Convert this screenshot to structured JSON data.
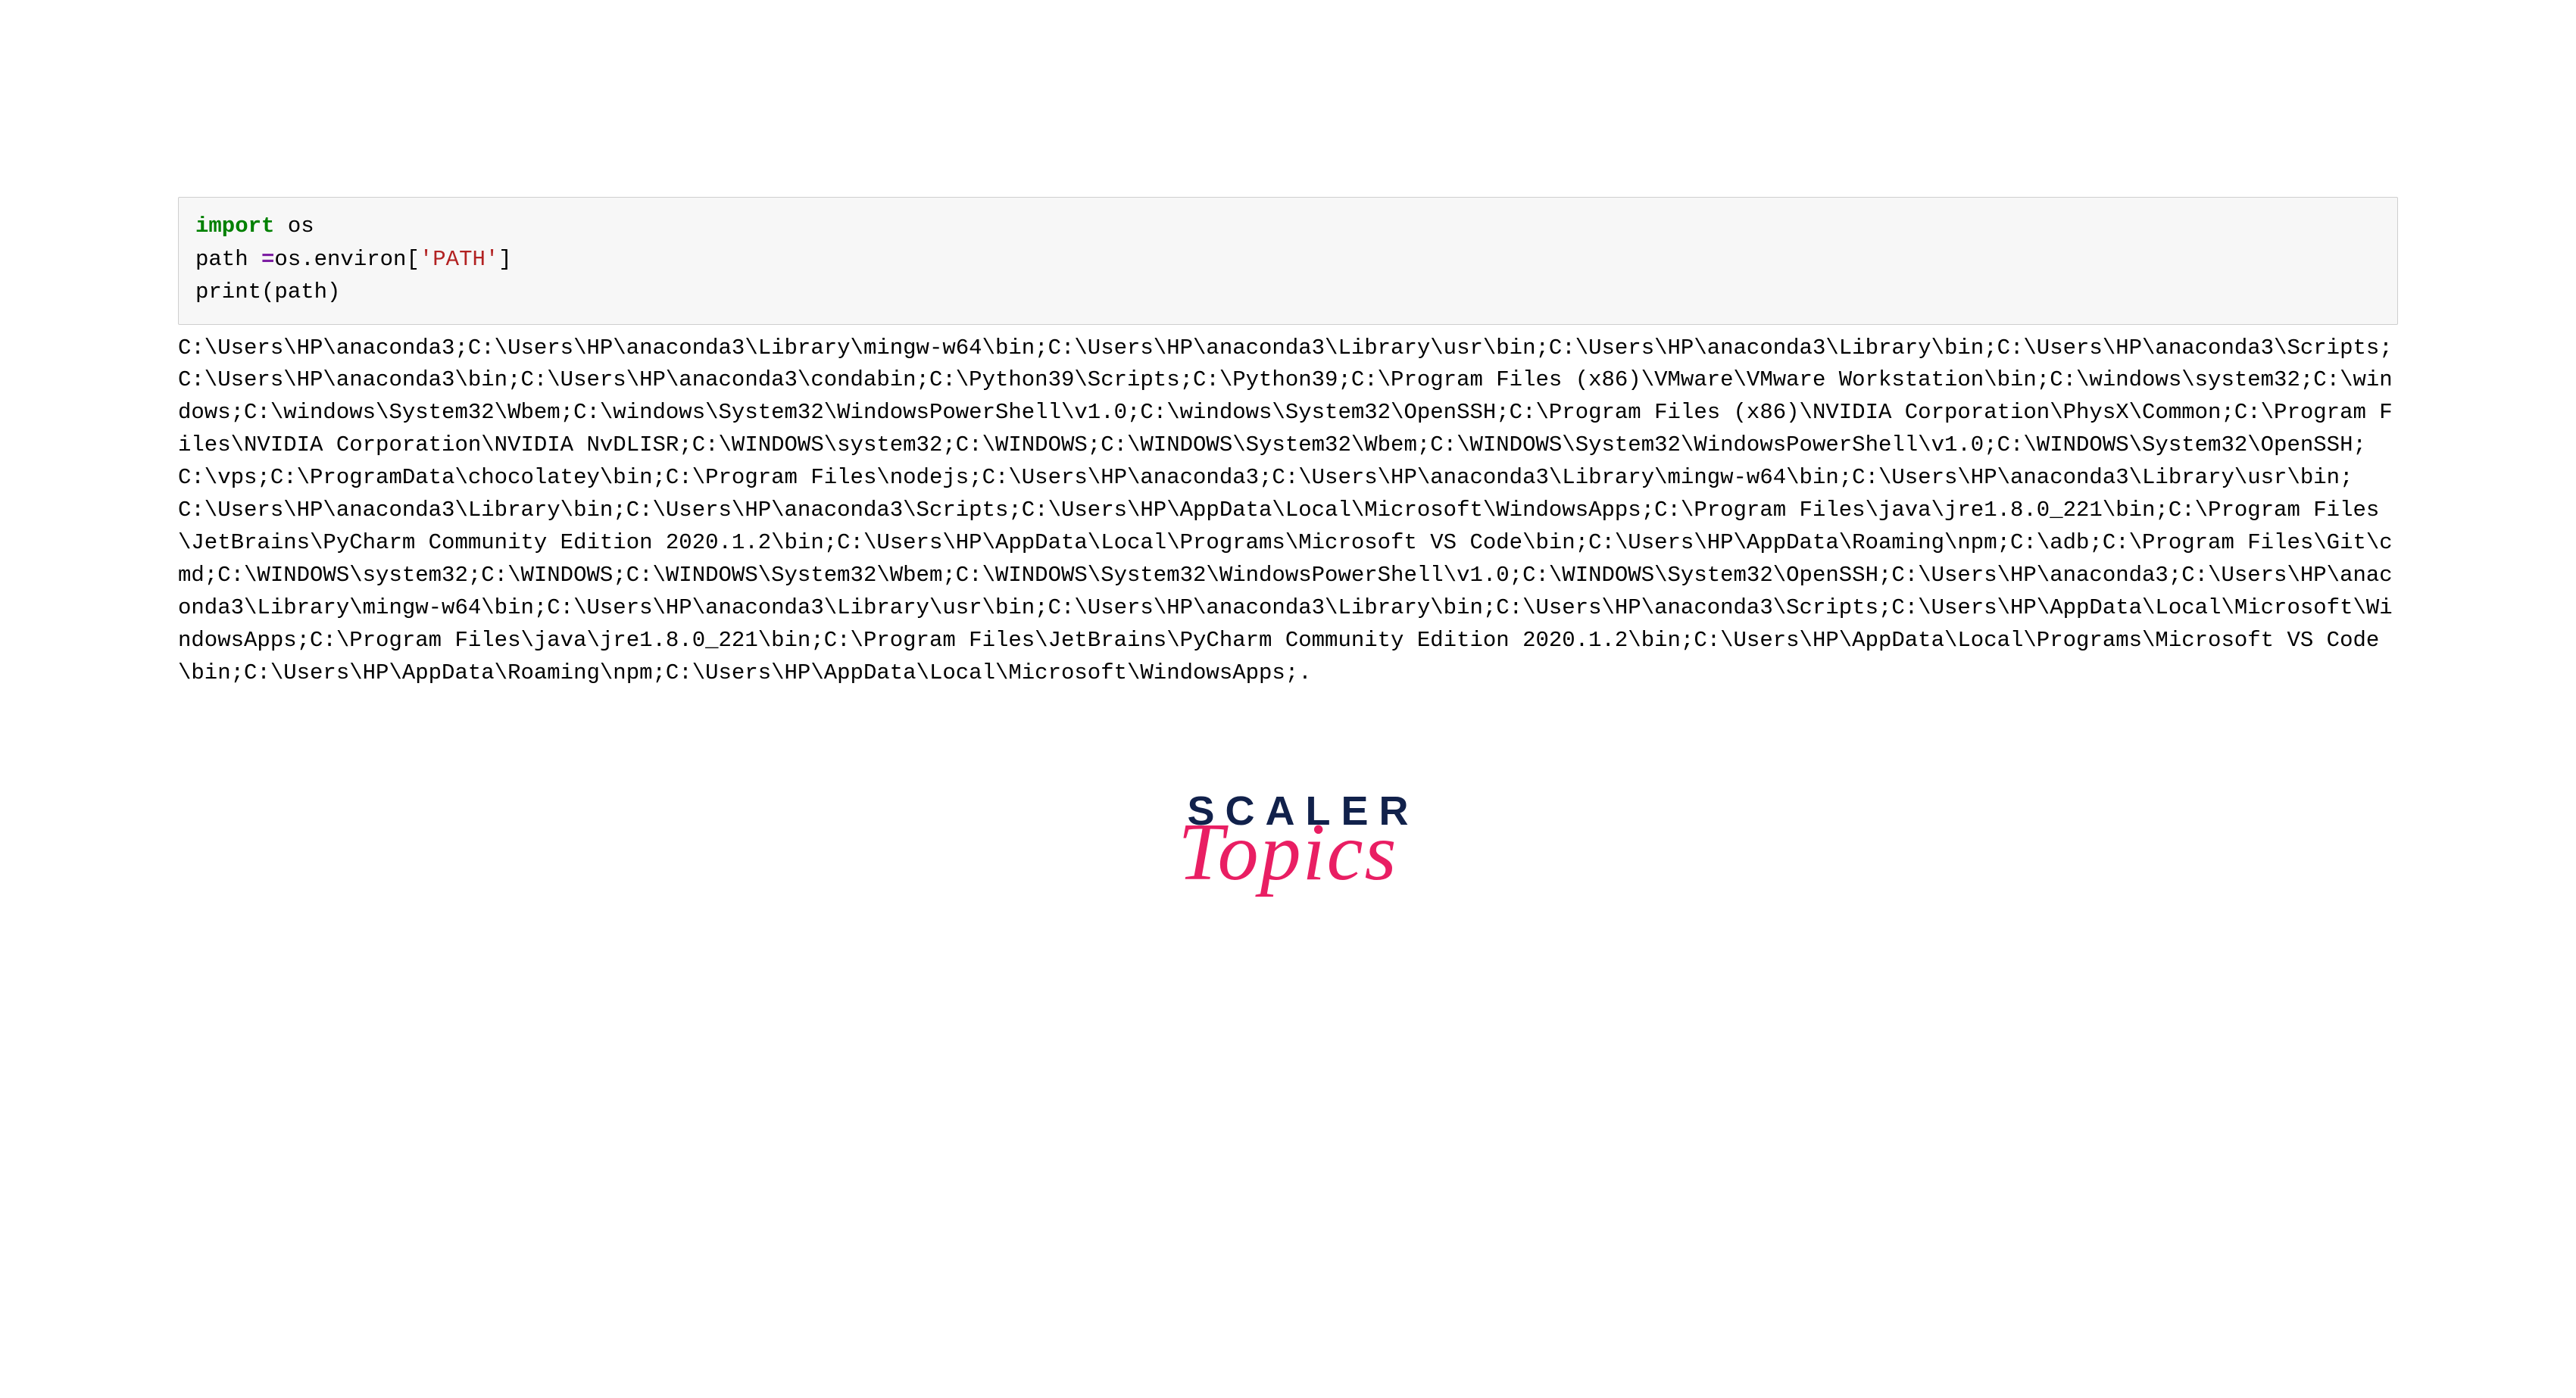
{
  "code": {
    "line1_kw": "import",
    "line1_mod": " os",
    "blank": "",
    "line2_a": "path ",
    "line2_op": "=",
    "line2_b": "os.environ[",
    "line2_str": "'PATH'",
    "line2_c": "]",
    "line3_fn": "print",
    "line3_rest": "(path)"
  },
  "output": "C:\\Users\\HP\\anaconda3;C:\\Users\\HP\\anaconda3\\Library\\mingw-w64\\bin;C:\\Users\\HP\\anaconda3\\Library\\usr\\bin;C:\\Users\\HP\\anaconda3\\Library\\bin;C:\\Users\\HP\\anaconda3\\Scripts;C:\\Users\\HP\\anaconda3\\bin;C:\\Users\\HP\\anaconda3\\condabin;C:\\Python39\\Scripts;C:\\Python39;C:\\Program Files (x86)\\VMware\\VMware Workstation\\bin;C:\\windows\\system32;C:\\windows;C:\\windows\\System32\\Wbem;C:\\windows\\System32\\WindowsPowerShell\\v1.0;C:\\windows\\System32\\OpenSSH;C:\\Program Files (x86)\\NVIDIA Corporation\\PhysX\\Common;C:\\Program Files\\NVIDIA Corporation\\NVIDIA NvDLISR;C:\\WINDOWS\\system32;C:\\WINDOWS;C:\\WINDOWS\\System32\\Wbem;C:\\WINDOWS\\System32\\WindowsPowerShell\\v1.0;C:\\WINDOWS\\System32\\OpenSSH;C:\\vps;C:\\ProgramData\\chocolatey\\bin;C:\\Program Files\\nodejs;C:\\Users\\HP\\anaconda3;C:\\Users\\HP\\anaconda3\\Library\\mingw-w64\\bin;C:\\Users\\HP\\anaconda3\\Library\\usr\\bin;C:\\Users\\HP\\anaconda3\\Library\\bin;C:\\Users\\HP\\anaconda3\\Scripts;C:\\Users\\HP\\AppData\\Local\\Microsoft\\WindowsApps;C:\\Program Files\\java\\jre1.8.0_221\\bin;C:\\Program Files\\JetBrains\\PyCharm Community Edition 2020.1.2\\bin;C:\\Users\\HP\\AppData\\Local\\Programs\\Microsoft VS Code\\bin;C:\\Users\\HP\\AppData\\Roaming\\npm;C:\\adb;C:\\Program Files\\Git\\cmd;C:\\WINDOWS\\system32;C:\\WINDOWS;C:\\WINDOWS\\System32\\Wbem;C:\\WINDOWS\\System32\\WindowsPowerShell\\v1.0;C:\\WINDOWS\\System32\\OpenSSH;C:\\Users\\HP\\anaconda3;C:\\Users\\HP\\anaconda3\\Library\\mingw-w64\\bin;C:\\Users\\HP\\anaconda3\\Library\\usr\\bin;C:\\Users\\HP\\anaconda3\\Library\\bin;C:\\Users\\HP\\anaconda3\\Scripts;C:\\Users\\HP\\AppData\\Local\\Microsoft\\WindowsApps;C:\\Program Files\\java\\jre1.8.0_221\\bin;C:\\Program Files\\JetBrains\\PyCharm Community Edition 2020.1.2\\bin;C:\\Users\\HP\\AppData\\Local\\Programs\\Microsoft VS Code\\bin;C:\\Users\\HP\\AppData\\Roaming\\npm;C:\\Users\\HP\\AppData\\Local\\Microsoft\\WindowsApps;.",
  "logo": {
    "primary": "SCALER",
    "secondary": "Topics"
  }
}
